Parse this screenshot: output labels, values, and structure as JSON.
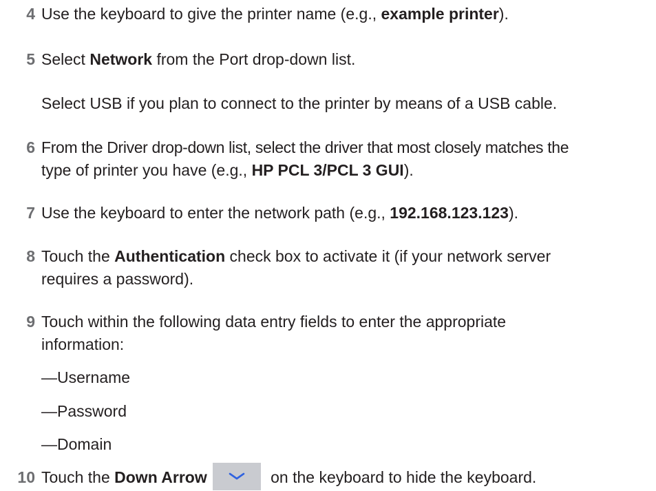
{
  "steps": [
    {
      "number": "4",
      "text_before": "Use the keyboard to give the printer name (e.g., ",
      "bold": "example printer",
      "text_after": ")."
    },
    {
      "number": "5",
      "text_before": "Select ",
      "bold": "Network",
      "text_after": " from the Port drop-down list.",
      "note": "Select USB if you plan to connect to the printer by means of a USB cable."
    },
    {
      "number": "6",
      "line1": "From the Driver drop-down list, select the driver that most closely matches the",
      "line2_before": "type of printer you have (e.g., ",
      "line2_bold": "HP PCL 3/PCL 3 GUI",
      "line2_after": ")."
    },
    {
      "number": "7",
      "text_before": "Use the keyboard to enter the network path (e.g., ",
      "bold": "192.168.123.123",
      "text_after": ")."
    },
    {
      "number": "8",
      "line1_before": "Touch the ",
      "line1_bold": "Authentication",
      "line1_after": " check box to activate it (if your network server",
      "line2": "requires a password)."
    },
    {
      "number": "9",
      "line1": "Touch within the following data entry fields to enter the appropriate",
      "line2": "information:",
      "fields": [
        "—Username",
        "—Password",
        "—Domain"
      ]
    },
    {
      "number": "10",
      "text_before": "Touch the ",
      "bold": "Down Arrow",
      "icon": "chevron-down-icon",
      "text_after": " on the keyboard to hide the keyboard."
    }
  ],
  "colors": {
    "step_number": "#6d6e71",
    "text": "#231f20",
    "key_background": "#c9cbd0",
    "key_arrow": "#2f62e0"
  }
}
